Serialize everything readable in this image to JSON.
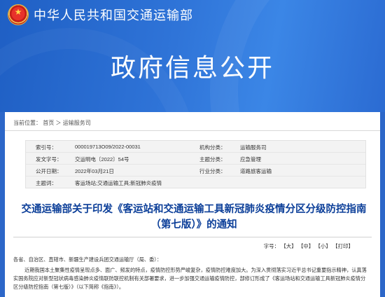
{
  "header": {
    "ministry_name": "中华人民共和国交通运输部",
    "section_title": "政府信息公开"
  },
  "breadcrumb": {
    "label": "当前位置：",
    "home": "首页",
    "sep": "＞",
    "current": "运输服务司"
  },
  "meta": {
    "rows": [
      {
        "k1": "索引号：",
        "v1": "000019713O09/2022-00031",
        "k2": "机构分类：",
        "v2": "运输服务司"
      },
      {
        "k1": "发文字号：",
        "v1": "交运明电〔2022〕54号",
        "k2": "主题分类：",
        "v2": "应急管理"
      },
      {
        "k1": "公开日期：",
        "v1": "2022年03月21日",
        "k2": "行业分类：",
        "v2": "道路旅客运输"
      },
      {
        "k1": "主题词：",
        "v1": "客运场站;交通运输工具;新冠肺炎疫情",
        "k2": "",
        "v2": ""
      }
    ]
  },
  "document": {
    "title": "交通运输部关于印发《客运站和交通运输工具新冠肺炎疫情分区分级防控指南（第七版）》的通知"
  },
  "font_size": {
    "label": "字号：",
    "large": "【大】",
    "medium": "【中】",
    "small": "【小】",
    "print": "【打印】"
  },
  "body": {
    "salutation": "各省、自治区、直辖市、新疆生产建设兵团交通运输厅（局、委）：",
    "para1": "近期我国本土聚集性疫情呈现点多、面广、频发的特点，疫情防控形势严峻复杂，疫情防控难度加大。为深入贯彻落实习近平总书记重要指示精神，认真落实国务院应对新型冠状病毒感染肺炎疫情联防联控机制有关部署要求，进一步加强交通运输疫情防控，部修订形成了《客运场站和交通运输工具新冠肺炎疫情分区分级防控指南（第七版）》（以下简称《指南》）。"
  },
  "colors": {
    "banner": "#2c67c9",
    "title_blue": "#0c3f99"
  }
}
